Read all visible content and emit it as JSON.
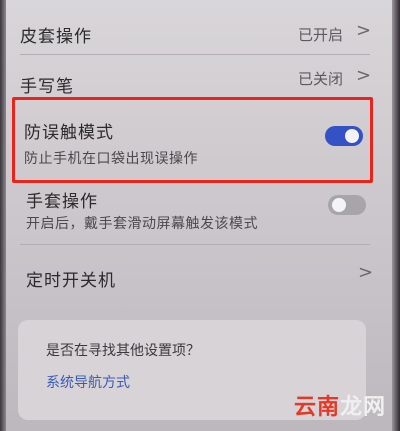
{
  "settings": [
    {
      "title": "皮套操作",
      "value": "已开启",
      "chevron": ">"
    },
    {
      "title": "手写笔",
      "value": "已关闭",
      "chevron": ">"
    }
  ],
  "anti_touch": {
    "title": "防误触模式",
    "subtitle": "防止手机在口袋出现误操作",
    "enabled": true
  },
  "glove": {
    "title": "手套操作",
    "subtitle": "开启后，戴手套滑动屏幕触发该模式",
    "enabled": false
  },
  "timer": {
    "title": "定时开关机",
    "chevron": ">"
  },
  "suggestion": {
    "question": "是否在寻找其他设置项？",
    "link": "系统导航方式"
  },
  "watermark": {
    "part1": "云南",
    "part2": "龙网"
  },
  "colors": {
    "accent": "#3452c5",
    "highlight": "#e8241c",
    "link": "#3a5bb5"
  }
}
